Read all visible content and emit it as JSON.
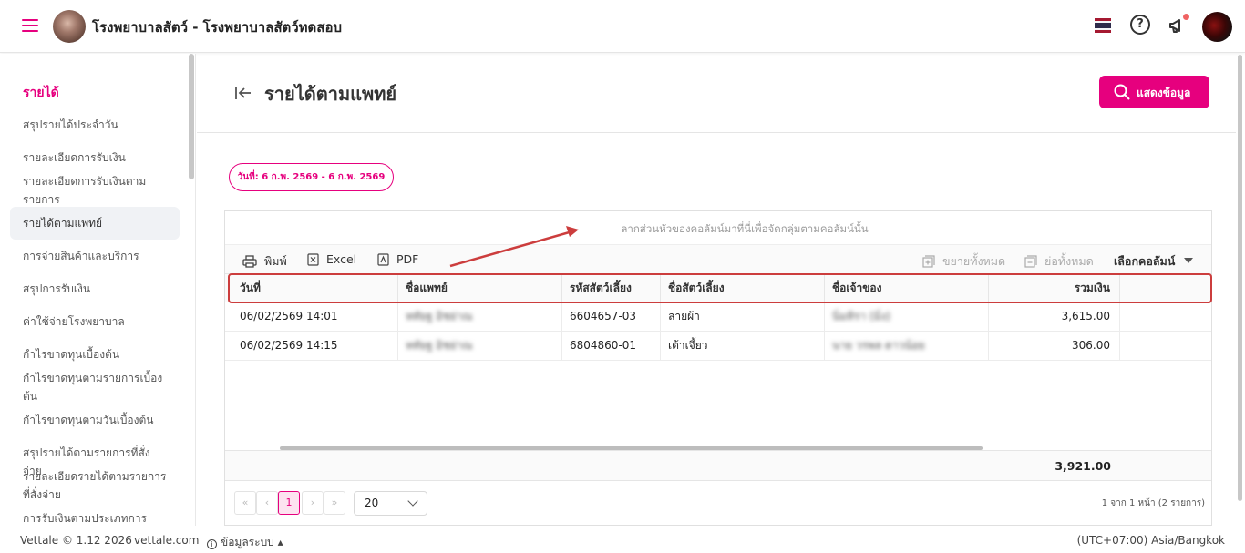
{
  "app": {
    "title": "โรงพยาบาลสัตว์ - โรงพยาบาลสัตว์ทดสอบ"
  },
  "colors": {
    "accent": "#e6007e",
    "annotation": "#cc3d3d"
  },
  "sidebar": {
    "header": "รายได้",
    "items": [
      {
        "label": "สรุปรายได้ประจำวัน"
      },
      {
        "label": "รายละเอียดการรับเงิน"
      },
      {
        "label": "รายละเอียดการรับเงินตามรายการ"
      },
      {
        "label": "รายได้ตามแพทย์",
        "active": true
      },
      {
        "label": "การจ่ายสินค้าและบริการ"
      },
      {
        "label": "สรุปการรับเงิน"
      },
      {
        "label": "ค่าใช้จ่ายโรงพยาบาล"
      },
      {
        "label": "กำไรขาดทุนเบื้องต้น"
      },
      {
        "label": "กำไรขาดทุนตามรายการเบื้องต้น"
      },
      {
        "label": "กำไรขาดทุนตามวันเบื้องต้น"
      },
      {
        "label": "สรุปรายได้ตามรายการที่สั่งจ่าย"
      },
      {
        "label": "รายละเอียดรายได้ตามรายการที่สั่งจ่าย"
      },
      {
        "label": "การรับเงินตามประเภทการชำระ"
      }
    ]
  },
  "page": {
    "title": "รายได้ตามแพทย์",
    "show_button": "แสดงข้อมูล",
    "date_range": "วันที่: 6 ก.พ. 2569 - 6 ก.พ. 2569"
  },
  "grid": {
    "group_hint": "ลากส่วนหัวของคอลัมน์มาที่นี่เพื่อจัดกลุ่มตามคอลัมน์นั้น",
    "toolbar": {
      "print": "พิมพ์",
      "excel": "Excel",
      "pdf": "PDF",
      "expand_all": "ขยายทั้งหมด",
      "collapse_all": "ย่อทั้งหมด",
      "column_chooser": "เลือกคอลัมน์"
    },
    "columns": [
      "วันที่",
      "ชื่อแพทย์",
      "รหัสสัตว์เลี้ยง",
      "ชื่อสัตว์เลี้ยง",
      "ชื่อเจ้าของ",
      "รวมเงิน"
    ],
    "rows": [
      {
        "date": "06/02/2569 14:01",
        "doctor": "หทัยฐ อิชย่าณ",
        "pet_code": "6604657-03",
        "pet_name": "ลายผ้า",
        "owner": "นิ่มทิรา (มิ่ง)",
        "total": "3,615.00"
      },
      {
        "date": "06/02/2569 14:15",
        "doctor": "หทัยฐ อิชย่าณ",
        "pet_code": "6804860-01",
        "pet_name": "เต้าเจี้ยว",
        "owner": "นาย วรพล ดาวน้อย",
        "total": "306.00"
      }
    ],
    "grand_total": "3,921.00",
    "pager": {
      "first": "«",
      "prev": "‹",
      "current": "1",
      "next": "›",
      "last": "»",
      "page_size": "20",
      "info": "1 จาก 1 หน้า (2 รายการ)"
    }
  },
  "footer": {
    "copyright": "Vettale © 1.12 2026",
    "site": "vettale.com",
    "system_info": "ข้อมูลระบบ",
    "timezone": "(UTC+07:00) Asia/Bangkok"
  }
}
